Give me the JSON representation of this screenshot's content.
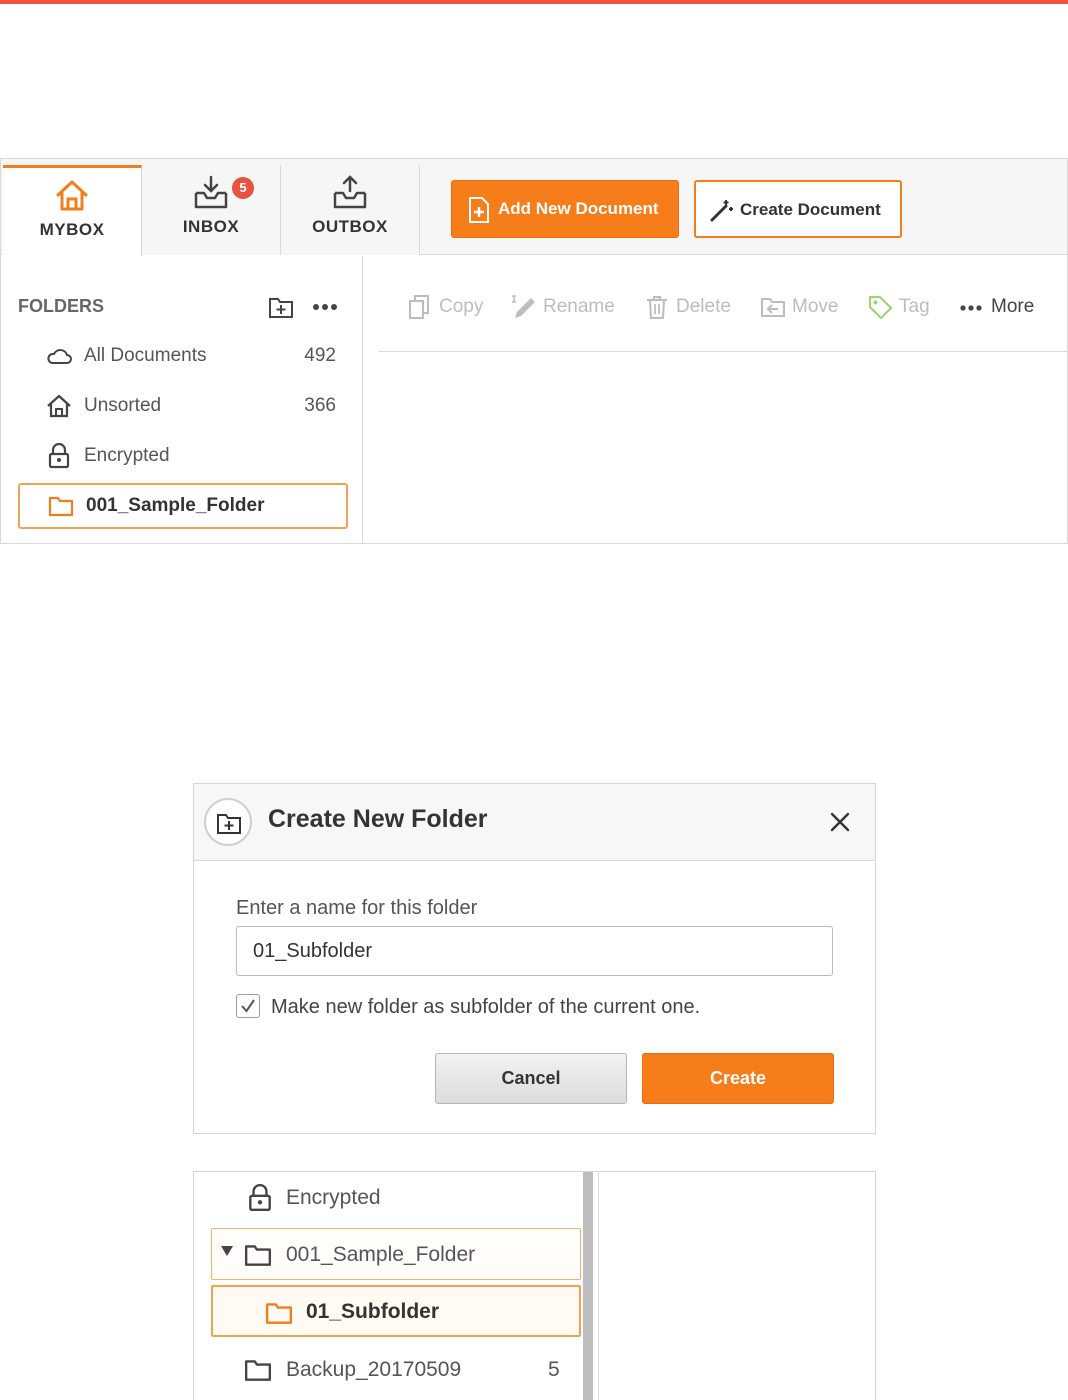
{
  "tabs": [
    {
      "label": "MYBOX",
      "icon": "home-icon",
      "active": true
    },
    {
      "label": "INBOX",
      "icon": "inbox-icon",
      "badge": "5"
    },
    {
      "label": "OUTBOX",
      "icon": "outbox-icon"
    }
  ],
  "header_buttons": {
    "add_new_document": "Add New Document",
    "create_document": "Create Document"
  },
  "sidebar": {
    "heading": "FOLDERS",
    "items": [
      {
        "label": "All Documents",
        "count": "492",
        "icon": "cloud-icon"
      },
      {
        "label": "Unsorted",
        "count": "366",
        "icon": "home-icon"
      },
      {
        "label": "Encrypted",
        "icon": "lock-icon"
      },
      {
        "label": "001_Sample_Folder",
        "icon": "folder-icon",
        "selected": true
      }
    ]
  },
  "toolbar": {
    "copy": "Copy",
    "rename": "Rename",
    "delete": "Delete",
    "move": "Move",
    "tag": "Tag",
    "more": "More"
  },
  "dialog": {
    "title": "Create New Folder",
    "field_label": "Enter a name for this folder",
    "field_value": "01_Subfolder",
    "checkbox_label": "Make new folder as subfolder of the current one.",
    "checkbox_checked": true,
    "cancel": "Cancel",
    "create": "Create"
  },
  "tree": {
    "items": [
      {
        "label": "Encrypted",
        "icon": "lock-icon"
      },
      {
        "label": "001_Sample_Folder",
        "icon": "folder-icon",
        "expanded": true
      },
      {
        "label": "01_Subfolder",
        "icon": "folder-icon",
        "selected": true
      },
      {
        "label": "Backup_20170509",
        "count": "5",
        "icon": "folder-icon"
      }
    ]
  },
  "colors": {
    "accent_orange": "#f67d1a",
    "top_bar_red": "#f0523c",
    "badge_red": "#e8533f"
  }
}
